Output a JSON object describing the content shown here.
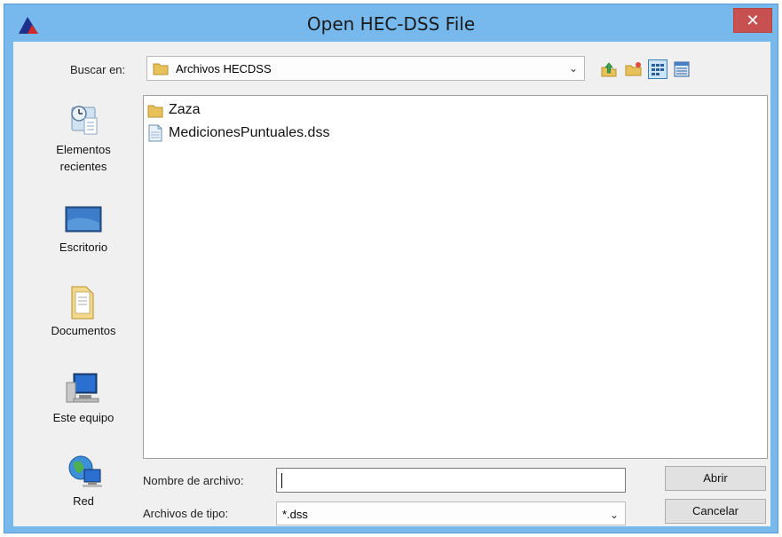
{
  "window": {
    "title": "Open HEC-DSS File",
    "close_glyph": "✕",
    "app_icon": "hec-dss-logo-icon"
  },
  "lookin": {
    "label": "Buscar en:",
    "value": "Archivos HECDSS"
  },
  "toolbar": {
    "icons": [
      "up-folder-icon",
      "new-folder-icon",
      "list-view-icon",
      "details-view-icon"
    ],
    "active_view": "list-view-icon"
  },
  "places": [
    {
      "label": "Elementos recientes",
      "icon": "recent-items-icon"
    },
    {
      "label": "Escritorio",
      "icon": "desktop-icon"
    },
    {
      "label": "Documentos",
      "icon": "documents-icon"
    },
    {
      "label": "Este equipo",
      "icon": "computer-icon"
    },
    {
      "label": "Red",
      "icon": "network-icon"
    }
  ],
  "files": [
    {
      "name": "Zaza",
      "type": "folder",
      "icon": "folder-icon"
    },
    {
      "name": "MedicionesPuntuales.dss",
      "type": "file",
      "icon": "file-icon"
    }
  ],
  "form": {
    "filename_label": "Nombre de archivo:",
    "filename_value": "",
    "filetype_label": "Archivos de tipo:",
    "filetype_value": "*.dss"
  },
  "buttons": {
    "open": "Abrir",
    "cancel": "Cancelar"
  },
  "colors": {
    "frame": "#77b9ec",
    "close": "#c75050",
    "client": "#f0f0f0",
    "folder": "#e8c15a"
  }
}
